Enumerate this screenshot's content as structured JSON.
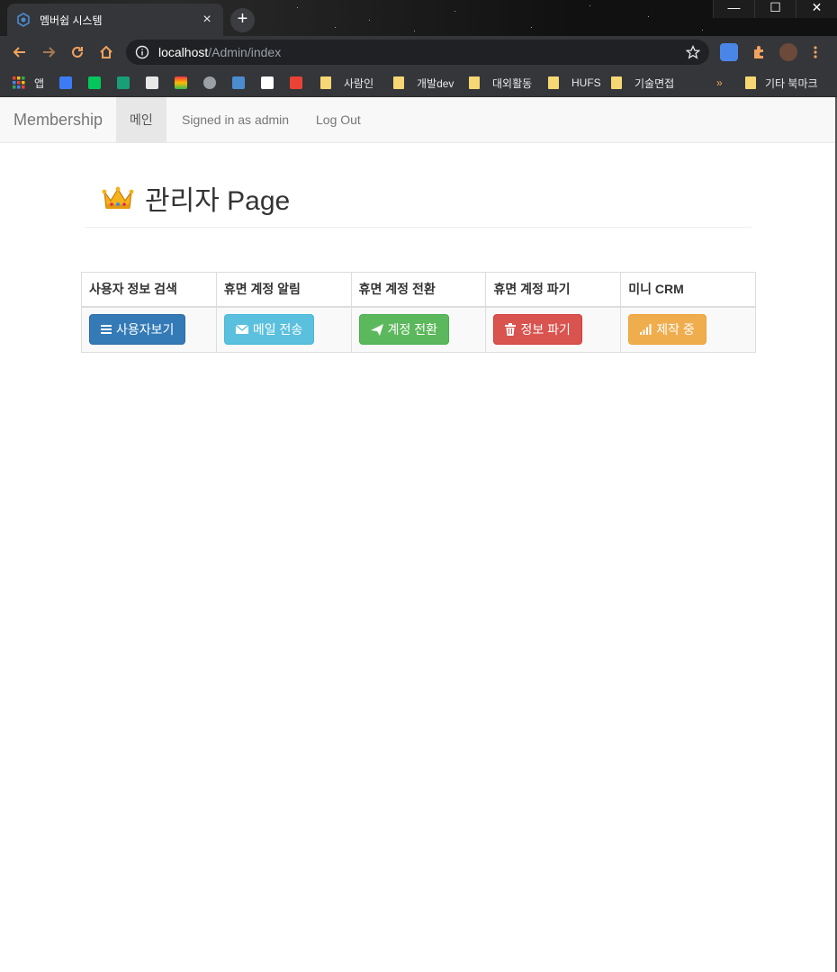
{
  "browser": {
    "tab_title": "멤버쉽 시스템",
    "tab_close": "×",
    "new_tab": "+",
    "url_host": "localhost",
    "url_path": "/Admin/index",
    "window_controls": [
      "—",
      "☐",
      "✕"
    ],
    "bookmarks": [
      {
        "label": "앱",
        "icon": "apps-grid-icon"
      },
      {
        "label": "사람인",
        "icon": "folder-icon"
      },
      {
        "label": "개발dev",
        "icon": "folder-icon"
      },
      {
        "label": "대외활동",
        "icon": "folder-icon"
      },
      {
        "label": "HUFS",
        "icon": "folder-icon"
      },
      {
        "label": "기술면접",
        "icon": "folder-icon"
      }
    ],
    "bookmarks_overflow": "»",
    "other_bookmarks": "기타 북마크"
  },
  "navbar": {
    "brand": "Membership",
    "items": [
      {
        "label": "메인",
        "active": true
      },
      {
        "label": "Signed in as admin",
        "active": false
      },
      {
        "label": "Log Out",
        "active": false
      }
    ]
  },
  "page": {
    "title": "관리자 Page",
    "title_icon": "crown-icon"
  },
  "table": {
    "headers": [
      "사용자 정보 검색",
      "휴면 계정 알림",
      "휴면 계정 전환",
      "휴면 계정 파기",
      "미니 CRM"
    ],
    "buttons": [
      {
        "label": "사용자보기",
        "icon": "list-icon",
        "color": "#337ab7"
      },
      {
        "label": "메일 전송",
        "icon": "envelope-icon",
        "color": "#5bc0de"
      },
      {
        "label": "계정 전환",
        "icon": "send-icon",
        "color": "#5cb85c"
      },
      {
        "label": "정보 파기",
        "icon": "trash-icon",
        "color": "#d9534f"
      },
      {
        "label": "제작 중",
        "icon": "signal-icon",
        "color": "#f0ad4e"
      }
    ]
  }
}
